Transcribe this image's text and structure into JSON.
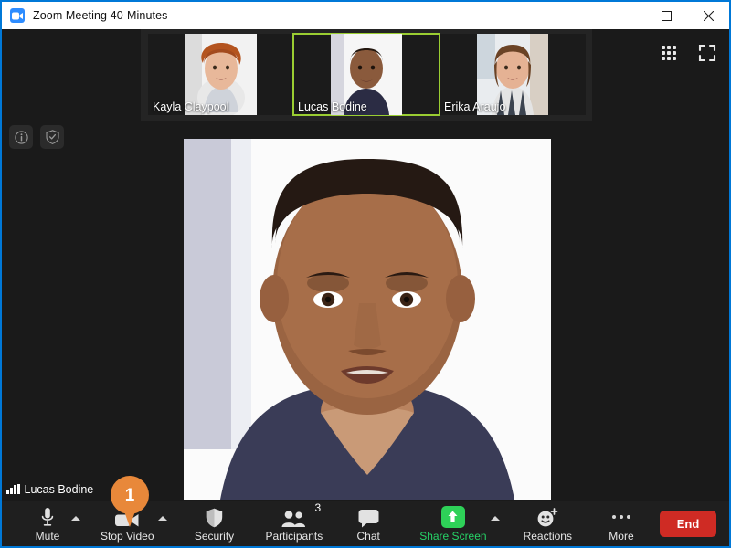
{
  "window": {
    "title": "Zoom Meeting 40-Minutes",
    "app_icon": "zoom-camera-icon",
    "controls": {
      "minimize": "minimize-icon",
      "maximize": "maximize-icon",
      "close": "close-icon"
    }
  },
  "colors": {
    "window_border": "#0078d7",
    "titlebar_bg": "#ffffff",
    "meeting_bg": "#1a1a1a",
    "filmstrip_bg": "#242424",
    "toolbar_bg": "#1f1f1f",
    "active_speaker_border": "#9acd32",
    "share_green": "#2ed158",
    "share_label_green": "#26d367",
    "end_red": "#cf2b24",
    "pin_orange": "#e8883a",
    "app_icon_blue": "#2d8cff"
  },
  "top_left_icons": [
    {
      "name": "meeting-info-icon",
      "glyph": "i"
    },
    {
      "name": "encryption-shield-icon",
      "glyph": "shield-check"
    }
  ],
  "top_right_icons": [
    {
      "name": "gallery-view-icon",
      "glyph": "grid-3x3"
    },
    {
      "name": "fullscreen-icon",
      "glyph": "expand-corners"
    }
  ],
  "filmstrip": {
    "participants": [
      {
        "name": "Kayla Claypool",
        "active": false
      },
      {
        "name": "Lucas Bodine",
        "active": true
      },
      {
        "name": "Erika Araujo",
        "active": false
      }
    ]
  },
  "stage": {
    "speaker": "Lucas Bodine"
  },
  "self_view": {
    "name": "Lucas Bodine",
    "audio_icon": "audio-level-bars-icon"
  },
  "annotation": {
    "marker_number": "1",
    "points_at": "stop-video-button"
  },
  "toolbar": {
    "items": [
      {
        "id": "mute",
        "label": "Mute",
        "icon": "microphone-icon",
        "has_chevron": true,
        "badge": null
      },
      {
        "id": "stop-video",
        "label": "Stop Video",
        "icon": "video-camera-icon",
        "has_chevron": true,
        "badge": null
      },
      {
        "id": "security",
        "label": "Security",
        "icon": "shield-icon",
        "has_chevron": false,
        "badge": null
      },
      {
        "id": "participants",
        "label": "Participants",
        "icon": "people-icon",
        "has_chevron": false,
        "badge": "3"
      },
      {
        "id": "chat",
        "label": "Chat",
        "icon": "speech-bubble-icon",
        "has_chevron": false,
        "badge": null
      },
      {
        "id": "share-screen",
        "label": "Share Screen",
        "icon": "share-arrow-up-icon",
        "has_chevron": true,
        "badge": null
      },
      {
        "id": "reactions",
        "label": "Reactions",
        "icon": "smiley-plus-icon",
        "has_chevron": false,
        "badge": null
      },
      {
        "id": "more",
        "label": "More",
        "icon": "ellipsis-icon",
        "has_chevron": false,
        "badge": null
      }
    ],
    "end_label": "End"
  }
}
